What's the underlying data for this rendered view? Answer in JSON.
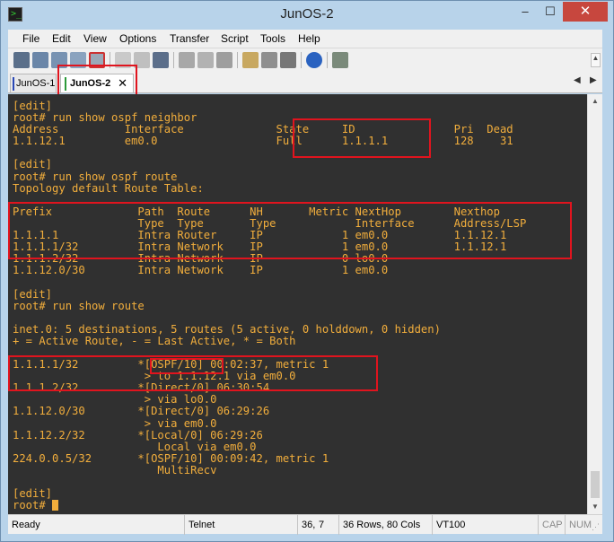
{
  "window": {
    "title": "JunOS-2",
    "minimize": "–",
    "maximize": "☐",
    "close": "✕"
  },
  "menu": [
    "File",
    "Edit",
    "View",
    "Options",
    "Transfer",
    "Script",
    "Tools",
    "Help"
  ],
  "toolbar": {
    "icons": [
      "connect-icon",
      "quick-connect-icon",
      "connect-in-tab-icon",
      "reconnect-icon",
      "disconnect-icon",
      "copy-icon",
      "paste-icon",
      "find-icon",
      "print-setup-icon",
      "print-icon",
      "print-screen-icon",
      "session-options-icon",
      "global-options-icon",
      "keymap-icon",
      "help-icon",
      "sftp-icon"
    ],
    "scroll_arrow": "▲"
  },
  "tabs": [
    {
      "label": "JunOS-1",
      "active": false
    },
    {
      "label": "JunOS-2",
      "active": true,
      "close": "✕"
    }
  ],
  "tab_nav": {
    "prev": "◀",
    "next": "▶"
  },
  "terminal": {
    "lines": [
      "[edit]",
      "root# run show ospf neighbor",
      "Address          Interface              State     ID               Pri  Dead",
      "1.1.12.1         em0.0                  Full      1.1.1.1          128    31",
      "",
      "[edit]",
      "root# run show ospf route",
      "Topology default Route Table:",
      "",
      "Prefix             Path  Route      NH       Metric NextHop        Nexthop",
      "                   Type  Type       Type            Interface      Address/LSP",
      "1.1.1.1            Intra Router     IP            1 em0.0          1.1.12.1",
      "1.1.1.1/32         Intra Network    IP            1 em0.0          1.1.12.1",
      "1.1.1.2/32         Intra Network    IP            0 lo0.0",
      "1.1.12.0/30        Intra Network    IP            1 em0.0",
      "",
      "[edit]",
      "root# run show route",
      "",
      "inet.0: 5 destinations, 5 routes (5 active, 0 holddown, 0 hidden)",
      "+ = Active Route, - = Last Active, * = Both",
      "",
      "1.1.1.1/32         *[OSPF/10] 00:02:37, metric 1",
      "                    > to 1.1.12.1 via em0.0",
      "1.1.1.2/32         *[Direct/0] 06:30:54",
      "                    > via lo0.0",
      "1.1.12.0/30        *[Direct/0] 06:29:26",
      "                    > via em0.0",
      "1.1.12.2/32        *[Local/0] 06:29:26",
      "                      Local via em0.0",
      "224.0.0.5/32       *[OSPF/10] 00:09:42, metric 1",
      "                      MultiRecv",
      "",
      "[edit]"
    ],
    "prompt": "root# "
  },
  "scrollbar": {
    "up": "▲",
    "down": "▼"
  },
  "status": {
    "ready": "Ready",
    "protocol": "Telnet",
    "cursor_row": "36,",
    "cursor_col": "7",
    "size": "36 Rows,  80 Cols",
    "terminal_type": "VT100",
    "cap": "CAP",
    "num": "NUM"
  },
  "colors": {
    "terminal_bg": "#303030",
    "terminal_fg": "#f2ae3c",
    "highlight": "#e0141e"
  }
}
